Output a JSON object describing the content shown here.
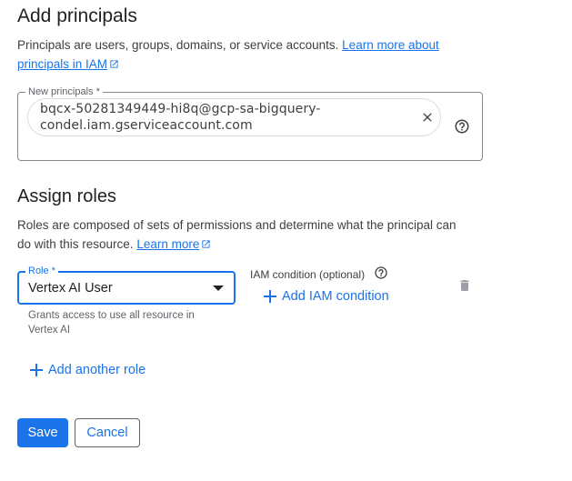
{
  "principals": {
    "title": "Add principals",
    "desc_text": "Principals are users, groups, domains, or service accounts. ",
    "link_part1": "Learn more about",
    "link_part2": "principals in IAM",
    "field_label": "New principals *",
    "chip_value": "bqcx-50281349449-hi8q@gcp-sa-bigquery-condel.iam.gserviceaccount.com"
  },
  "roles": {
    "title": "Assign roles",
    "desc_line1": "Roles are composed of sets of permissions and determine what the principal can",
    "desc_line2": "do with this resource. ",
    "link": "Learn more",
    "role_label": "Role *",
    "role_value": "Vertex AI User",
    "role_hint": "Grants access to use all resource in Vertex AI",
    "condition_label": "IAM condition (optional)",
    "add_condition": "Add IAM condition",
    "add_role": "Add another role"
  },
  "actions": {
    "save": "Save",
    "cancel": "Cancel"
  },
  "colors": {
    "accent": "#1a73e8",
    "text": "#202124",
    "muted": "#5f6368"
  },
  "icons": [
    "external-link-icon",
    "close-icon",
    "help-icon",
    "dropdown-caret-icon",
    "plus-icon",
    "trash-icon"
  ]
}
